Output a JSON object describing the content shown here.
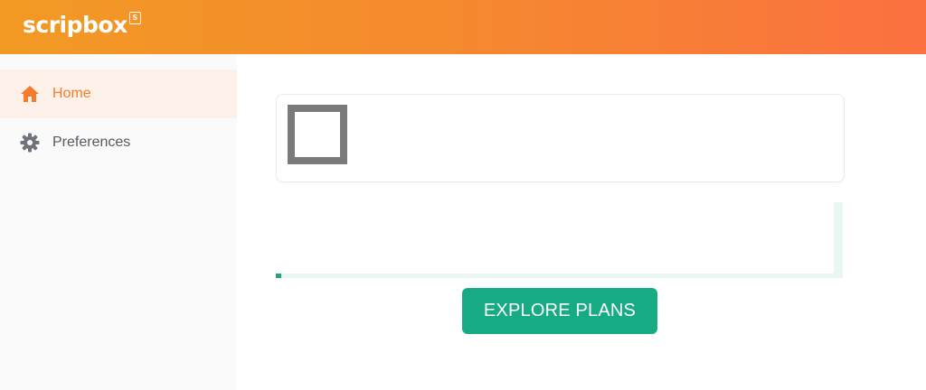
{
  "header": {
    "logo_text": "scripbox",
    "logo_badge": "S",
    "colors": {
      "gradient_start": "#f29a24",
      "gradient_end": "#fb7140"
    }
  },
  "sidebar": {
    "items": [
      {
        "label": "Home",
        "icon": "home-icon",
        "active": true
      },
      {
        "label": "Preferences",
        "icon": "gear-icon",
        "active": false
      }
    ],
    "active_color": "#f57c2b"
  },
  "main": {
    "card": {
      "image": "placeholder-square-icon"
    },
    "cta": {
      "label": "EXPLORE PLANS",
      "color": "#17ab83"
    }
  }
}
